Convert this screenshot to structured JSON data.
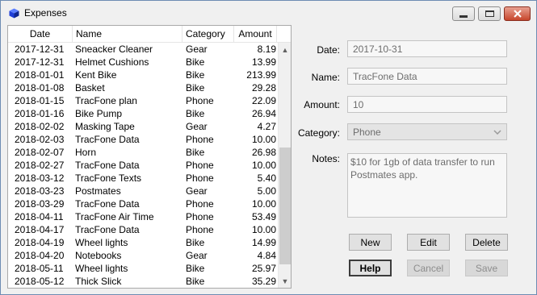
{
  "window": {
    "title": "Expenses"
  },
  "list": {
    "columns": [
      "Date",
      "Name",
      "Category",
      "Amount"
    ],
    "rows": [
      {
        "date": "2017-12-31",
        "name": "Sneacker Cleaner",
        "category": "Gear",
        "amount": "8.19"
      },
      {
        "date": "2017-12-31",
        "name": "Helmet Cushions",
        "category": "Bike",
        "amount": "13.99"
      },
      {
        "date": "2018-01-01",
        "name": "Kent Bike",
        "category": "Bike",
        "amount": "213.99"
      },
      {
        "date": "2018-01-08",
        "name": "Basket",
        "category": "Bike",
        "amount": "29.28"
      },
      {
        "date": "2018-01-15",
        "name": "TracFone plan",
        "category": "Phone",
        "amount": "22.09"
      },
      {
        "date": "2018-01-16",
        "name": "Bike Pump",
        "category": "Bike",
        "amount": "26.94"
      },
      {
        "date": "2018-02-02",
        "name": "Masking Tape",
        "category": "Gear",
        "amount": "4.27"
      },
      {
        "date": "2018-02-03",
        "name": "TracFone Data",
        "category": "Phone",
        "amount": "10.00"
      },
      {
        "date": "2018-02-07",
        "name": "Horn",
        "category": "Bike",
        "amount": "26.98"
      },
      {
        "date": "2018-02-27",
        "name": "TracFone Data",
        "category": "Phone",
        "amount": "10.00"
      },
      {
        "date": "2018-03-12",
        "name": "TracFone Texts",
        "category": "Phone",
        "amount": "5.40"
      },
      {
        "date": "2018-03-23",
        "name": "Postmates",
        "category": "Gear",
        "amount": "5.00"
      },
      {
        "date": "2018-03-29",
        "name": "TracFone Data",
        "category": "Phone",
        "amount": "10.00"
      },
      {
        "date": "2018-04-11",
        "name": "TracFone Air Time",
        "category": "Phone",
        "amount": "53.49"
      },
      {
        "date": "2018-04-17",
        "name": "TracFone Data",
        "category": "Phone",
        "amount": "10.00"
      },
      {
        "date": "2018-04-19",
        "name": "Wheel lights",
        "category": "Bike",
        "amount": "14.99"
      },
      {
        "date": "2018-04-20",
        "name": "Notebooks",
        "category": "Gear",
        "amount": "4.84"
      },
      {
        "date": "2018-05-11",
        "name": "Wheel lights",
        "category": "Bike",
        "amount": "25.97"
      },
      {
        "date": "2018-05-12",
        "name": "Thick Slick",
        "category": "Bike",
        "amount": "35.29"
      }
    ],
    "scroll_up_glyph": "▲",
    "scroll_down_glyph": "▼"
  },
  "form": {
    "date_label": "Date:",
    "date_value": "2017-10-31",
    "name_label": "Name:",
    "name_value": "TracFone Data",
    "amount_label": "Amount:",
    "amount_value": "10",
    "category_label": "Category:",
    "category_value": "Phone",
    "notes_label": "Notes:",
    "notes_value": "$10 for 1gb of data transfer to run Postmates app."
  },
  "buttons": {
    "new": "New",
    "edit": "Edit",
    "delete": "Delete",
    "help": "Help",
    "cancel": "Cancel",
    "save": "Save"
  },
  "icons": {
    "app": "app-cube-icon",
    "minimize": "minimize-icon",
    "maximize": "maximize-icon",
    "close": "close-icon",
    "dropdown": "chevron-down-icon"
  },
  "colors": {
    "close_button": "#c7462c",
    "app_icon": "#1f3fd8",
    "scrollbar_thumb": "#cdcdcd"
  }
}
